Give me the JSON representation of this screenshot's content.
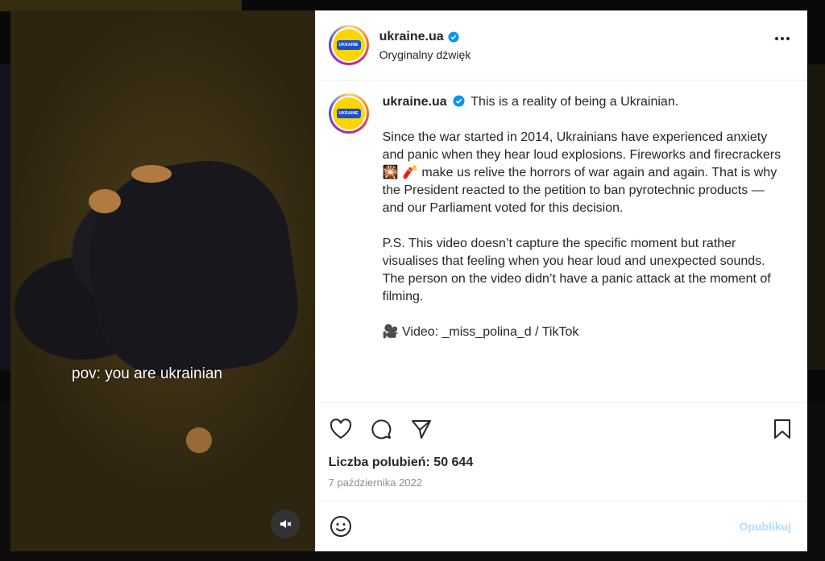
{
  "account": {
    "username": "ukraine.ua",
    "audio_label": "Oryginalny dźwięk",
    "logo_text": "UKRAINE",
    "verified": true
  },
  "video": {
    "caption_overlay": "pov: you are ukrainian",
    "mute_icon": "speaker-muted-icon"
  },
  "post": {
    "username": "ukraine.ua",
    "first_line": "This is a reality of being a Ukrainian.",
    "paragraph2_a": "Since the war started in 2014, Ukrainians have experienced anxiety and panic when they hear loud explosions. Fireworks and firecrackers",
    "emoji_sparkler": "🎇",
    "emoji_firecracker": "🧨",
    "paragraph2_b": "make us relive the horrors of war again and again. That is why the President reacted to the petition to ban pyrotechnic products — and our Parliament voted for this decision.",
    "paragraph3": "P.S. This video doesn’t capture the specific moment but rather visualises that feeling when you hear loud and unexpected sounds. The person on the video didn’t have a panic attack at the moment of filming.",
    "video_credit_emoji": "🎥",
    "video_credit": "Video: _miss_polina_d / TikTok"
  },
  "stats": {
    "likes": "Liczba polubień: 50 644",
    "date": "7 października 2022"
  },
  "comment_box": {
    "placeholder": "",
    "publish_label": "Opublikuj"
  },
  "colors": {
    "verified_blue": "#0095f6",
    "logo_yellow": "#ffd500",
    "logo_blue": "#1f4fc9",
    "publish_disabled": "#b3dbff"
  }
}
